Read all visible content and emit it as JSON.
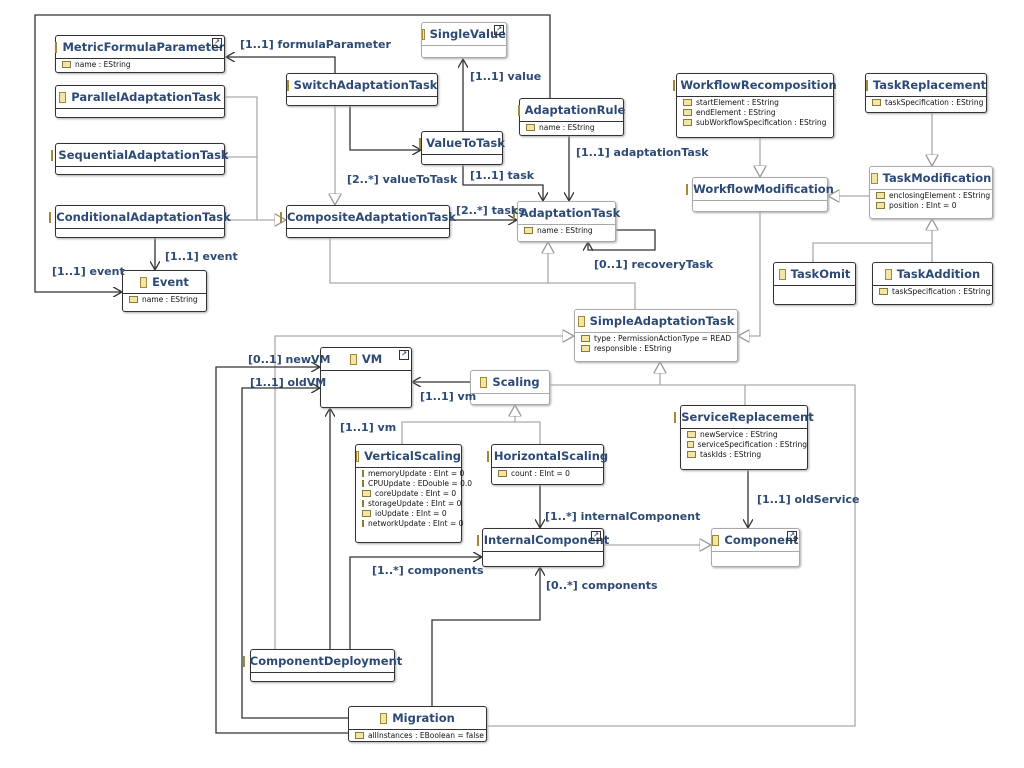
{
  "classes": {
    "mfp": {
      "name": "MetricFormulaParameter",
      "attrs": [
        "name : EString"
      ]
    },
    "parallel": {
      "name": "ParallelAdaptationTask",
      "attrs": []
    },
    "sequential": {
      "name": "SequentialAdaptationTask",
      "attrs": []
    },
    "conditional": {
      "name": "ConditionalAdaptationTask",
      "attrs": []
    },
    "event": {
      "name": "Event",
      "attrs": [
        "name : EString"
      ]
    },
    "switch": {
      "name": "SwitchAdaptationTask",
      "attrs": []
    },
    "single": {
      "name": "SingleValue",
      "attrs": []
    },
    "vtt": {
      "name": "ValueToTask",
      "attrs": []
    },
    "rule": {
      "name": "AdaptationRule",
      "attrs": [
        "name : EString"
      ]
    },
    "composite": {
      "name": "CompositeAdaptationTask",
      "attrs": []
    },
    "atask": {
      "name": "AdaptationTask",
      "attrs": [
        "name : EString"
      ]
    },
    "wrecomp": {
      "name": "WorkflowRecomposition",
      "attrs": [
        "startElement : EString",
        "endElement : EString",
        "subWorkflowSpecification : EString"
      ]
    },
    "trepl": {
      "name": "TaskReplacement",
      "attrs": [
        "taskSpecification : EString"
      ]
    },
    "wmod": {
      "name": "WorkflowModification",
      "attrs": []
    },
    "tmod": {
      "name": "TaskModification",
      "attrs": [
        "enclosingElement : EString",
        "position : EInt = 0"
      ]
    },
    "tomit": {
      "name": "TaskOmit",
      "attrs": []
    },
    "tadd": {
      "name": "TaskAddition",
      "attrs": [
        "taskSpecification : EString"
      ]
    },
    "simple": {
      "name": "SimpleAdaptationTask",
      "attrs": [
        "type : PermissionActionType = READ",
        "responsible : EString"
      ]
    },
    "vm": {
      "name": "VM",
      "attrs": []
    },
    "scaling": {
      "name": "Scaling",
      "attrs": []
    },
    "vscale": {
      "name": "VerticalScaling",
      "attrs": [
        "memoryUpdate : EInt = 0",
        "CPUUpdate : EDouble = 0.0",
        "coreUpdate : EInt = 0",
        "storageUpdate : EInt = 0",
        "ioUpdate : EInt = 0",
        "networkUpdate : EInt = 0"
      ]
    },
    "hscale": {
      "name": "HorizontalScaling",
      "attrs": [
        "count : EInt = 0"
      ]
    },
    "srepl": {
      "name": "ServiceReplacement",
      "attrs": [
        "newService : EString",
        "serviceSpecification : EString",
        "taskIds : EString"
      ]
    },
    "icomp": {
      "name": "InternalComponent",
      "attrs": []
    },
    "comp": {
      "name": "Component",
      "attrs": []
    },
    "cdep": {
      "name": "ComponentDeployment",
      "attrs": []
    },
    "migr": {
      "name": "Migration",
      "attrs": [
        "allInstances : EBoolean = false"
      ]
    }
  },
  "labels": {
    "formulaParameter": "[1..1] formulaParameter",
    "value": "[1..1] value",
    "valueToTask": "[2..*] valueToTask",
    "task": "[1..1] task",
    "adaptationTask": "[1..1] adaptationTask",
    "tasks": "[2..*] tasks",
    "recoveryTask": "[0..1] recoveryTask",
    "event1": "[1..1] event",
    "event2": "[1..1] event",
    "newVM": "[0..1] newVM",
    "oldVM": "[1..1] oldVM",
    "vm1": "[1..1] vm",
    "vm2": "[1..1] vm",
    "internalComponent": "[1..*] internalComponent",
    "oldService": "[1..1] oldService",
    "components1": "[1..*] components",
    "components2": "[0..*] components"
  }
}
